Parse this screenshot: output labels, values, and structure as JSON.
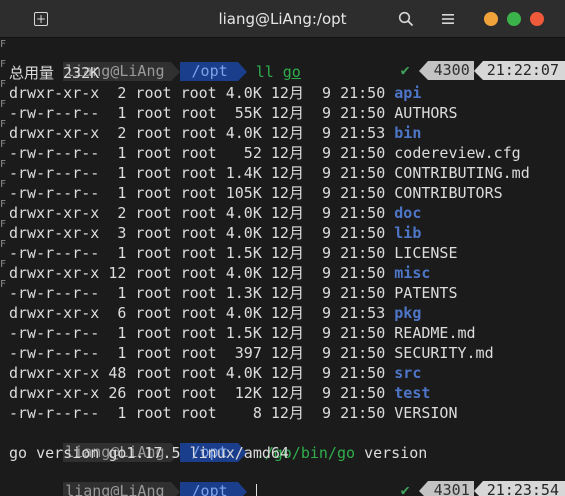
{
  "window": {
    "title": "liang@LiAng:/opt"
  },
  "colors": {
    "dir": "#4e76c8",
    "path_bg": "#1b3e8c",
    "success": "#3fa35a",
    "dot_min": "#f1a33b",
    "dot_max": "#3bb34a",
    "dot_close": "#ef5a3a"
  },
  "prompt1": {
    "user": "liang@LiAng",
    "path": "/opt",
    "cmd_name": "ll",
    "cmd_arg": "go",
    "check": "✔",
    "num": "4300",
    "time": "21:22:07"
  },
  "total_line": "总用量 232K",
  "listing": [
    {
      "perm": "drwxr-xr-x",
      "links": " 2",
      "owner": "root",
      "group": "root",
      "size": "4.0K",
      "month": "12月",
      "day": "9",
      "time": "21:50",
      "name": "api",
      "dir": true
    },
    {
      "perm": "-rw-r--r--",
      "links": " 1",
      "owner": "root",
      "group": "root",
      "size": " 55K",
      "month": "12月",
      "day": "9",
      "time": "21:50",
      "name": "AUTHORS",
      "dir": false
    },
    {
      "perm": "drwxr-xr-x",
      "links": " 2",
      "owner": "root",
      "group": "root",
      "size": "4.0K",
      "month": "12月",
      "day": "9",
      "time": "21:53",
      "name": "bin",
      "dir": true
    },
    {
      "perm": "-rw-r--r--",
      "links": " 1",
      "owner": "root",
      "group": "root",
      "size": "  52",
      "month": "12月",
      "day": "9",
      "time": "21:50",
      "name": "codereview.cfg",
      "dir": false
    },
    {
      "perm": "-rw-r--r--",
      "links": " 1",
      "owner": "root",
      "group": "root",
      "size": "1.4K",
      "month": "12月",
      "day": "9",
      "time": "21:50",
      "name": "CONTRIBUTING.md",
      "dir": false
    },
    {
      "perm": "-rw-r--r--",
      "links": " 1",
      "owner": "root",
      "group": "root",
      "size": "105K",
      "month": "12月",
      "day": "9",
      "time": "21:50",
      "name": "CONTRIBUTORS",
      "dir": false
    },
    {
      "perm": "drwxr-xr-x",
      "links": " 2",
      "owner": "root",
      "group": "root",
      "size": "4.0K",
      "month": "12月",
      "day": "9",
      "time": "21:50",
      "name": "doc",
      "dir": true
    },
    {
      "perm": "drwxr-xr-x",
      "links": " 3",
      "owner": "root",
      "group": "root",
      "size": "4.0K",
      "month": "12月",
      "day": "9",
      "time": "21:50",
      "name": "lib",
      "dir": true
    },
    {
      "perm": "-rw-r--r--",
      "links": " 1",
      "owner": "root",
      "group": "root",
      "size": "1.5K",
      "month": "12月",
      "day": "9",
      "time": "21:50",
      "name": "LICENSE",
      "dir": false
    },
    {
      "perm": "drwxr-xr-x",
      "links": "12",
      "owner": "root",
      "group": "root",
      "size": "4.0K",
      "month": "12月",
      "day": "9",
      "time": "21:50",
      "name": "misc",
      "dir": true
    },
    {
      "perm": "-rw-r--r--",
      "links": " 1",
      "owner": "root",
      "group": "root",
      "size": "1.3K",
      "month": "12月",
      "day": "9",
      "time": "21:50",
      "name": "PATENTS",
      "dir": false
    },
    {
      "perm": "drwxr-xr-x",
      "links": " 6",
      "owner": "root",
      "group": "root",
      "size": "4.0K",
      "month": "12月",
      "day": "9",
      "time": "21:53",
      "name": "pkg",
      "dir": true
    },
    {
      "perm": "-rw-r--r--",
      "links": " 1",
      "owner": "root",
      "group": "root",
      "size": "1.5K",
      "month": "12月",
      "day": "9",
      "time": "21:50",
      "name": "README.md",
      "dir": false
    },
    {
      "perm": "-rw-r--r--",
      "links": " 1",
      "owner": "root",
      "group": "root",
      "size": " 397",
      "month": "12月",
      "day": "9",
      "time": "21:50",
      "name": "SECURITY.md",
      "dir": false
    },
    {
      "perm": "drwxr-xr-x",
      "links": "48",
      "owner": "root",
      "group": "root",
      "size": "4.0K",
      "month": "12月",
      "day": "9",
      "time": "21:50",
      "name": "src",
      "dir": true
    },
    {
      "perm": "drwxr-xr-x",
      "links": "26",
      "owner": "root",
      "group": "root",
      "size": " 12K",
      "month": "12月",
      "day": "9",
      "time": "21:50",
      "name": "test",
      "dir": true
    },
    {
      "perm": "-rw-r--r--",
      "links": " 1",
      "owner": "root",
      "group": "root",
      "size": "   8",
      "month": "12月",
      "day": "9",
      "time": "21:50",
      "name": "VERSION",
      "dir": false
    }
  ],
  "prompt2": {
    "user": "liang@LiAng",
    "path": "/opt",
    "cmd_name": "./go/bin/go",
    "cmd_arg": "version"
  },
  "version_output": "go version go1.17.5 linux/amd64",
  "prompt3": {
    "user": "liang@LiAng",
    "path": "/opt",
    "check": "✔",
    "num": "4301",
    "time": "21:23:54"
  },
  "icons": {
    "new_tab": "new-tab-icon",
    "search": "search-icon",
    "menu": "hamburger-menu-icon"
  }
}
